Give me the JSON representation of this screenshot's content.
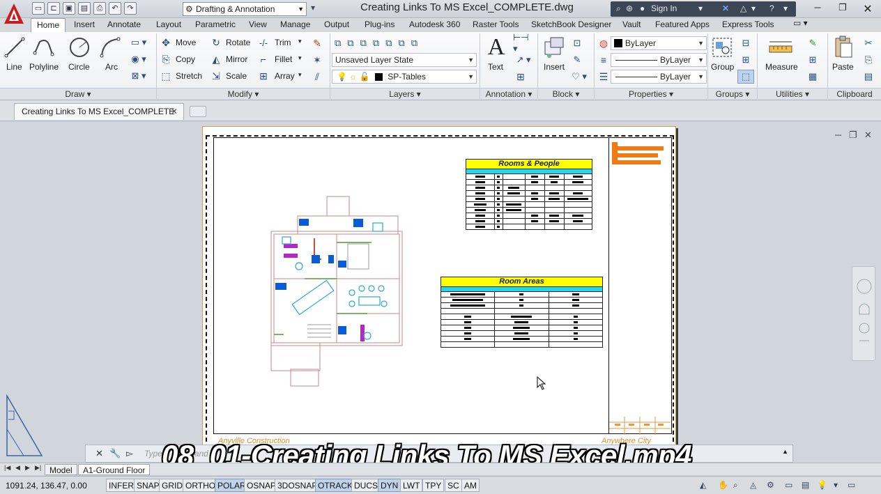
{
  "titlebar": {
    "workspace": "Drafting & Annotation",
    "document_title": "Creating Links To MS Excel_COMPLETE.dwg",
    "sign_in": "Sign In"
  },
  "ribbon_tabs": [
    "Home",
    "Insert",
    "Annotate",
    "Layout",
    "Parametric",
    "View",
    "Manage",
    "Output",
    "Plug-ins",
    "Autodesk 360",
    "Raster Tools",
    "SketchBook Designer",
    "Vault",
    "Featured Apps",
    "Express Tools"
  ],
  "draw": {
    "title": "Draw",
    "line": "Line",
    "polyline": "Polyline",
    "circle": "Circle",
    "arc": "Arc"
  },
  "modify": {
    "title": "Modify",
    "move": "Move",
    "rotate": "Rotate",
    "trim": "Trim",
    "copy": "Copy",
    "mirror": "Mirror",
    "fillet": "Fillet",
    "stretch": "Stretch",
    "scale": "Scale",
    "array": "Array"
  },
  "layers": {
    "title": "Layers",
    "layer_state": "Unsaved Layer State",
    "current_layer": "SP-Tables"
  },
  "annotation": {
    "title": "Annotation",
    "text": "Text"
  },
  "block": {
    "title": "Block",
    "insert": "Insert"
  },
  "properties": {
    "title": "Properties",
    "color": "ByLayer",
    "linetype": "ByLayer",
    "lineweight": "ByLayer"
  },
  "groups": {
    "title": "Groups",
    "group": "Group"
  },
  "utilities": {
    "title": "Utilities",
    "measure": "Measure"
  },
  "clipboard": {
    "title": "Clipboard",
    "paste": "Paste"
  },
  "doc_tab": {
    "label": "Creating Links To MS Excel_COMPLETE"
  },
  "drawing": {
    "table1_title": "Rooms & People",
    "table2_title": "Room Areas",
    "footer_left": "Anyville Construction",
    "footer_right": "Anywhere City"
  },
  "command": {
    "placeholder": "Type a command"
  },
  "layout_tabs": {
    "model": "Model",
    "layout1": "A1-Ground Floor"
  },
  "status": {
    "coords": "1091.24, 136.47, 0.00",
    "toggles": [
      "INFER",
      "SNAP",
      "GRID",
      "ORTHO",
      "POLAR",
      "OSNAP",
      "3DOSNAP",
      "OTRACK",
      "DUCS",
      "DYN",
      "LWT",
      "TPY",
      "SC",
      "AM"
    ],
    "active": [
      "POLAR",
      "OTRACK",
      "DYN"
    ]
  },
  "caption": "08_01-Creating Links To MS Excel.mp4",
  "colors": {
    "accent": "#2b4d80",
    "sheet_border": "#e39a3c",
    "table_title": "#ffff00",
    "table_header": "#22d8f0"
  }
}
